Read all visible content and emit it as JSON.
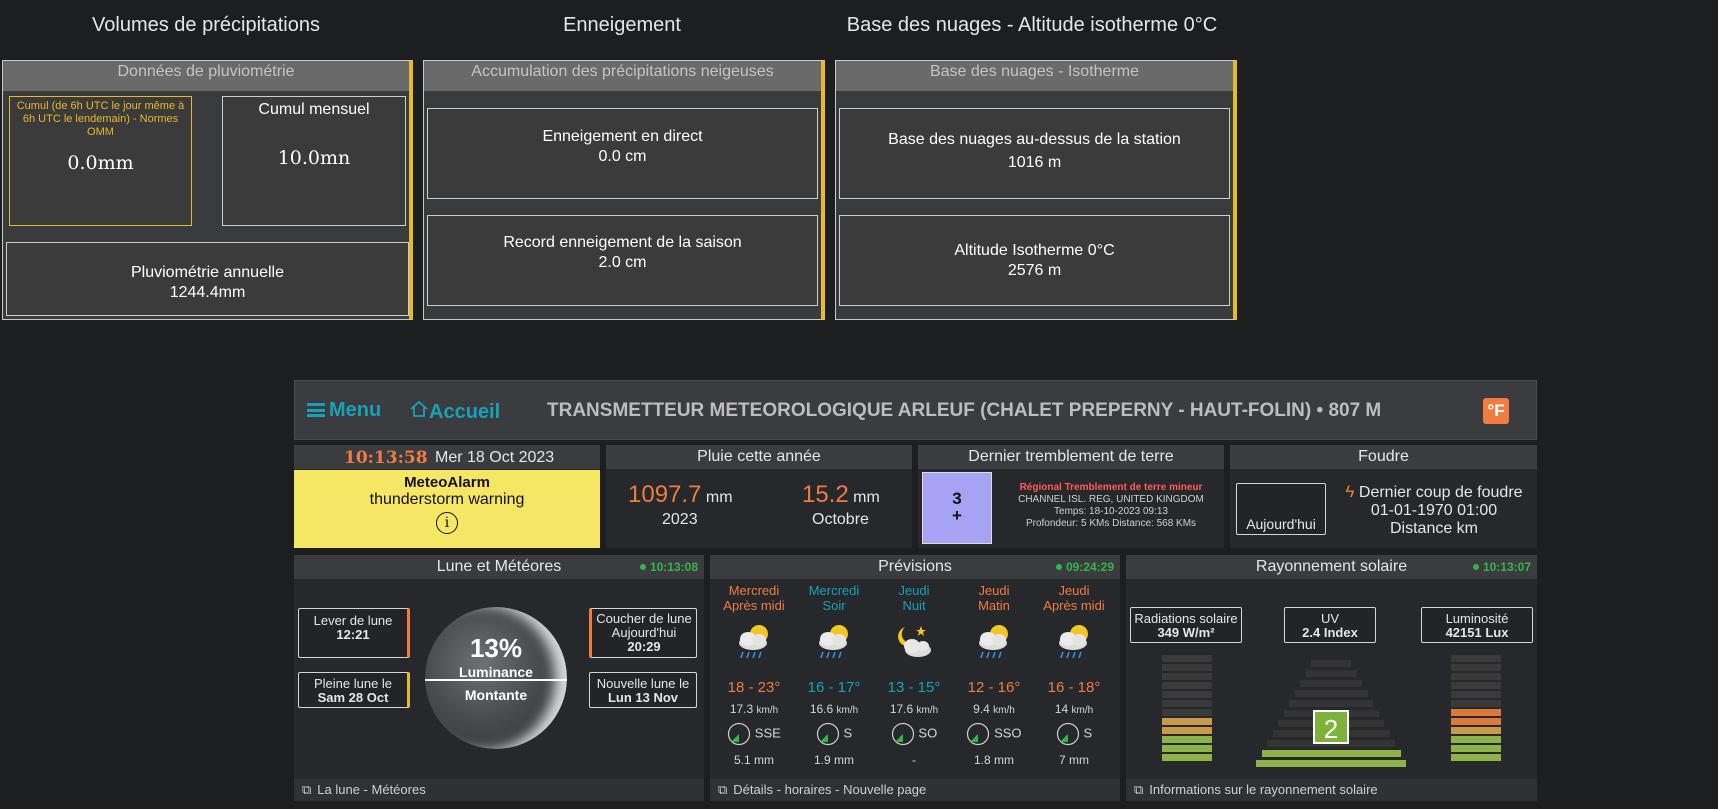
{
  "top": {
    "precip": {
      "section_title": "Volumes de précipitations",
      "header": "Données de pluviométrie",
      "cumul_label": "Cumul (de 6h UTC le jour même à 6h UTC le lendemain) - Normes OMM",
      "cumul_value": "0.0mm",
      "monthly_label": "Cumul mensuel",
      "monthly_value": "10.0mn",
      "annual_label": "Pluviométrie annuelle",
      "annual_value": "1244.4mm"
    },
    "snow": {
      "section_title": "Enneigement",
      "header": "Accumulation des précipitations neigeuses",
      "live_label": "Enneigement en direct",
      "live_value": "0.0 cm",
      "record_label": "Record enneigement de la saison",
      "record_value": "2.0 cm"
    },
    "clouds": {
      "section_title": "Base des nuages - Altitude isotherme 0°C",
      "header": "Base des nuages - Isotherme",
      "base_label": "Base des nuages au-dessus de la station",
      "base_value": "1016 m",
      "iso_label": "Altitude Isotherme 0°C",
      "iso_value": "2576 m"
    }
  },
  "nav": {
    "menu": "Menu",
    "home": "Accueil",
    "title": "TRANSMETTEUR METEOROLOGIQUE ARLEUF (CHALET PREPERNY - HAUT-FOLIN)",
    "altitude": "807 M",
    "unit_toggle": "°F",
    "accent": "#17a2b8"
  },
  "clock": {
    "time": "10:13:58",
    "date": "Mer 18 Oct 2023",
    "alarm_title": "MeteoAlarm",
    "alarm_text": "thunderstorm warning",
    "alarm_icon": "info-icon",
    "alarm_color": "#f5e663"
  },
  "rain_year": {
    "title": "Pluie cette année",
    "year_value": "1097.7",
    "year_unit": "mm",
    "year_label": "2023",
    "month_value": "15.2",
    "month_unit": "mm",
    "month_label": "Octobre"
  },
  "quake": {
    "title": "Dernier tremblement de terre",
    "magnitude": "3",
    "magnitude_suffix": "+",
    "type": "Régional Tremblement de terre mineur",
    "place": "CHANNEL ISL. REG, UNITED KINGDOM",
    "time": "Temps: 18-10-2023 09:13",
    "depth": "Profondeur: 5 KMs Distance: 568 KMs"
  },
  "lightning": {
    "title": "Foudre",
    "today_label": "Aujourd'hui",
    "last_label": "Dernier coup de foudre",
    "last_date": "01-01-1970 01:00",
    "distance": "Distance km"
  },
  "moon": {
    "title": "Lune et Météores",
    "updated": "10:13:08",
    "rise_label": "Lever de lune",
    "rise_value": "12:21",
    "set_label": "Coucher de lune",
    "set_day": "Aujourd'hui",
    "set_value": "20:29",
    "full_label": "Pleine lune le",
    "full_value": "Sam 28 Oct",
    "new_label": "Nouvelle lune le",
    "new_value": "Lun 13 Nov",
    "percent": "13%",
    "luminance": "Luminance",
    "phase": "Montante",
    "footer": "La lune - Météores"
  },
  "forecast": {
    "title": "Prévisions",
    "updated": "09:24:29",
    "footer": "Détails - horaires - Nouvelle page",
    "items": [
      {
        "day": "Mercredi",
        "period": "Après midi",
        "color": "#f07c41",
        "temp": "18 - 23°",
        "temp_color": "#f07c41",
        "wind": "17.3",
        "dir": "SSE",
        "rain": "5.1 mm",
        "icon": "cloud-sun-rain-icon"
      },
      {
        "day": "Mercredi",
        "period": "Soir",
        "color": "#17a2b8",
        "temp": "16 - 17°",
        "temp_color": "#17a2b8",
        "wind": "16.6",
        "dir": "S",
        "rain": "1.9 mm",
        "icon": "cloud-sun-rain-icon"
      },
      {
        "day": "Jeudi",
        "period": "Nuit",
        "color": "#17a2b8",
        "temp": "13 - 15°",
        "temp_color": "#17a2b8",
        "wind": "17.6",
        "dir": "SO",
        "rain": "-",
        "icon": "moon-cloud-icon"
      },
      {
        "day": "Jeudi",
        "period": "Matin",
        "color": "#f07c41",
        "temp": "12 - 16°",
        "temp_color": "#f07c41",
        "wind": "9.4",
        "dir": "SSO",
        "rain": "1.8 mm",
        "icon": "cloud-sun-rain-icon"
      },
      {
        "day": "Jeudi",
        "period": "Après midi",
        "color": "#f07c41",
        "temp": "16 - 18°",
        "temp_color": "#f07c41",
        "wind": "14",
        "dir": "S",
        "rain": "7 mm",
        "icon": "cloud-sun-rain-icon"
      }
    ],
    "wind_unit": "km/h"
  },
  "solar": {
    "title": "Rayonnement solaire",
    "updated": "10:13:07",
    "rad_label": "Radiations solaire",
    "rad_value": "349 W/m²",
    "uv_label": "UV",
    "uv_value": "2.4 Index",
    "lux_label": "Luminosité",
    "lux_value": "42151 Lux",
    "uv_index_display": "2",
    "footer": "Informations sur le rayonnement solaire"
  }
}
